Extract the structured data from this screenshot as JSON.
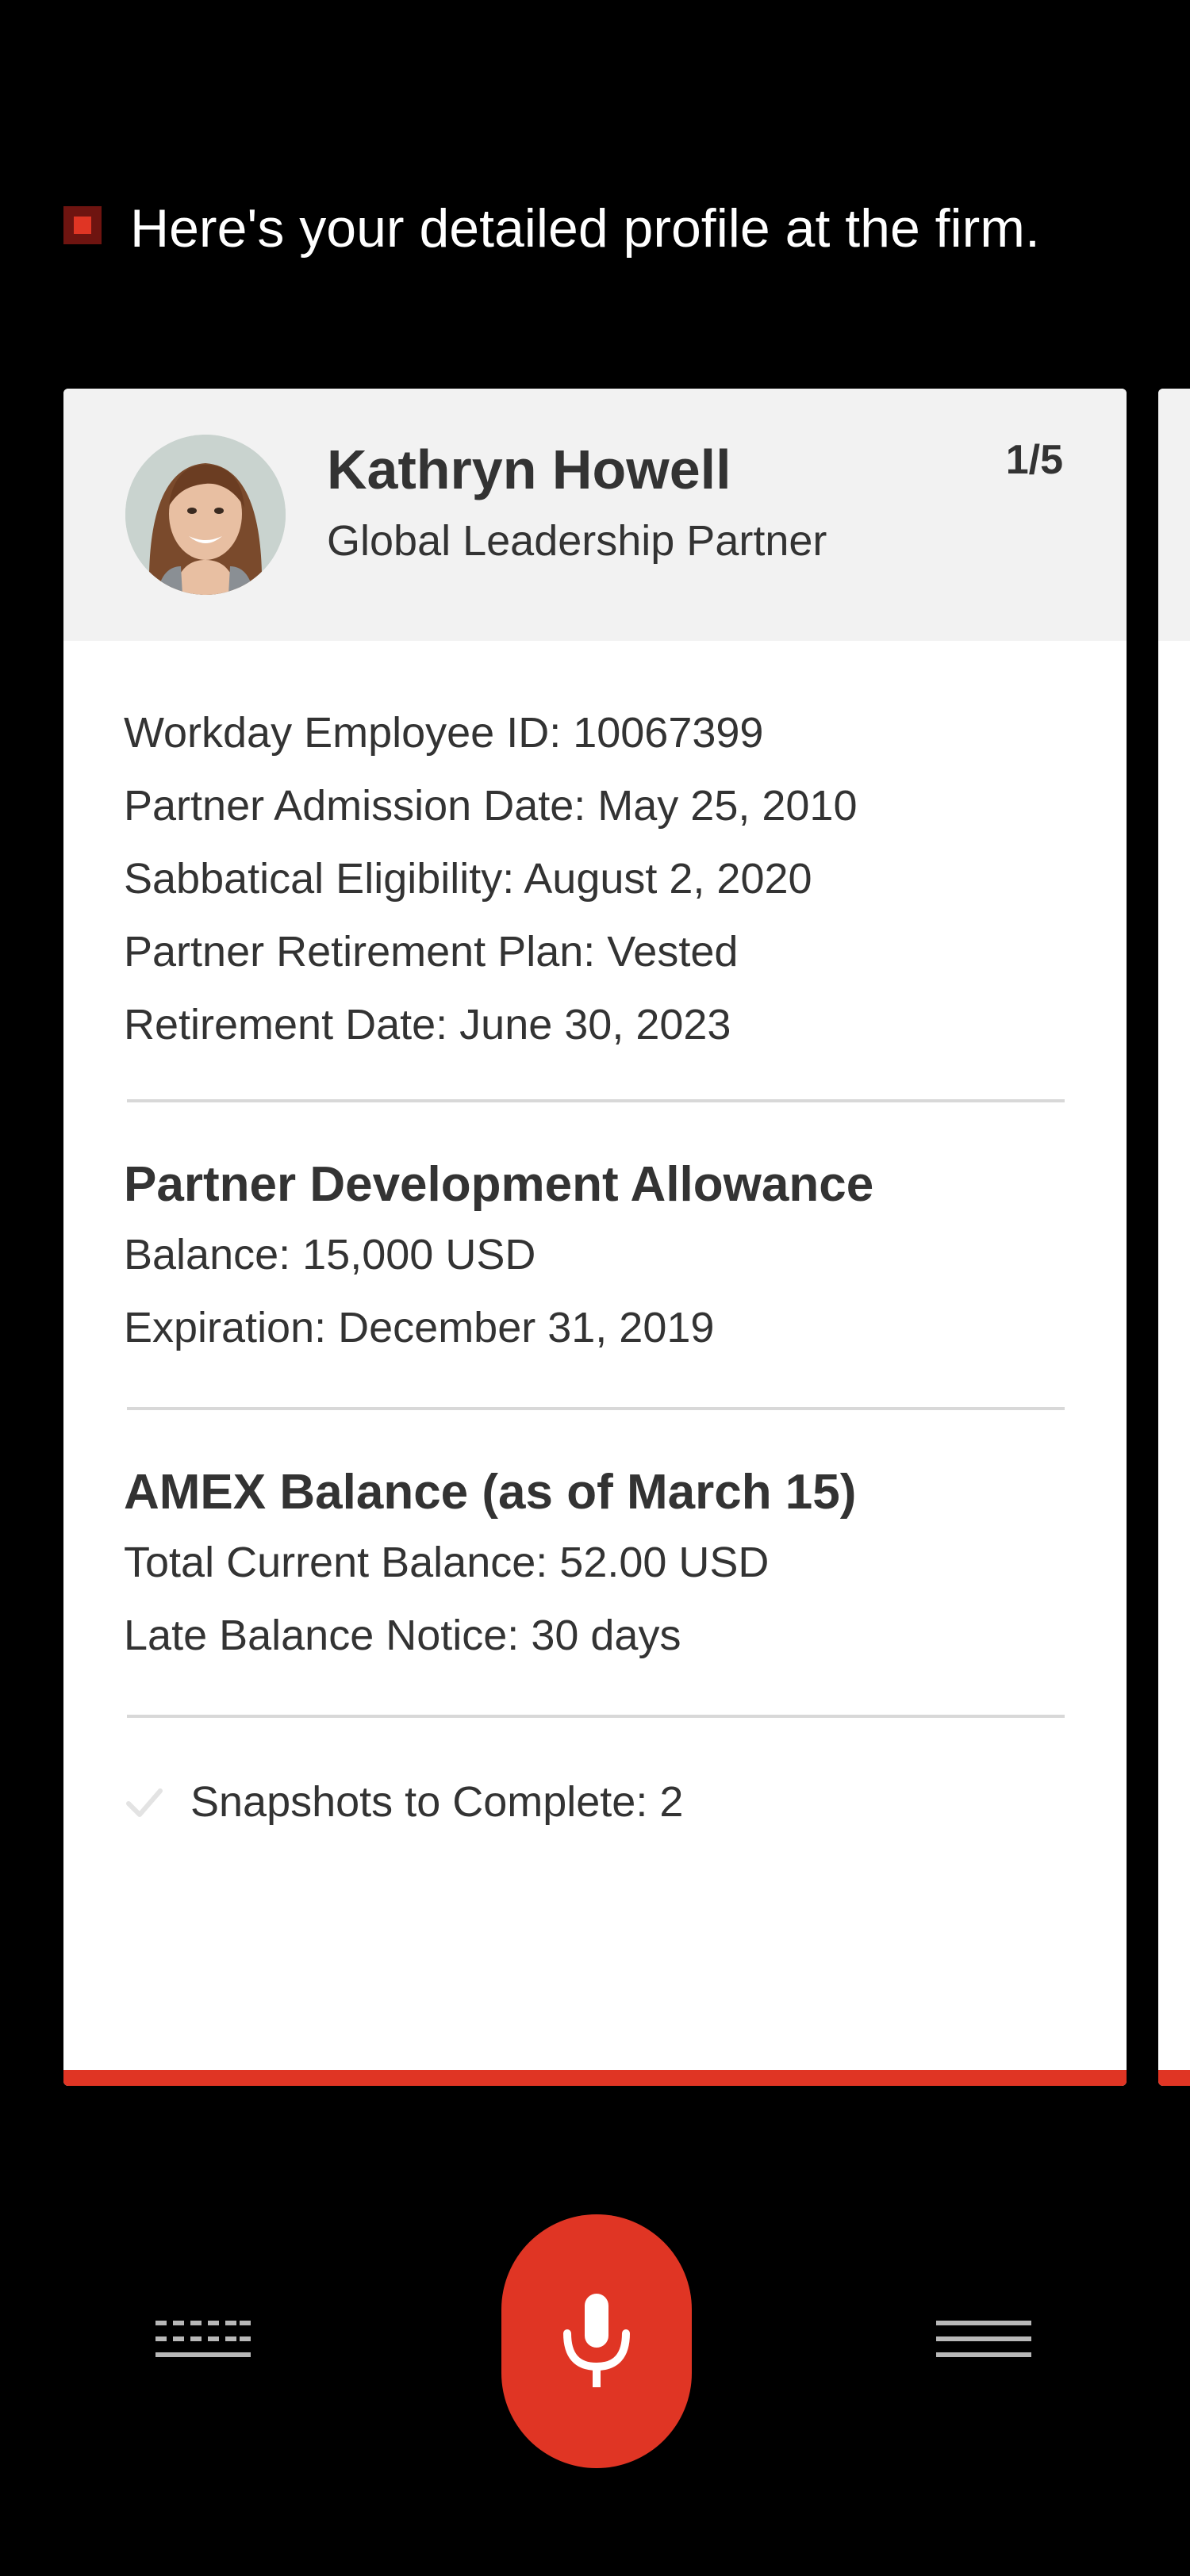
{
  "assistant": {
    "message": "Here's your detailed profile at the firm."
  },
  "profile_card": {
    "name": "Kathryn Howell",
    "role": "Global Leadership Partner",
    "pager": "1/5",
    "details": [
      "Workday Employee ID: 10067399",
      "Partner Admission Date: May 25, 2010",
      "Sabbatical Eligibility: August 2, 2020",
      "Partner Retirement Plan: Vested",
      "Retirement Date: June 30, 2023"
    ],
    "allowance": {
      "heading": "Partner Development Allowance",
      "lines": [
        "Balance: 15,000 USD",
        "Expiration: December 31, 2019"
      ]
    },
    "amex": {
      "heading": "AMEX Balance (as of March 15)",
      "lines": [
        "Total Current Balance: 52.00 USD",
        "Late Balance Notice: 30 days"
      ]
    },
    "snapshots": "Snapshots to Complete: 2"
  },
  "icons": {
    "keyboard": "keyboard-icon",
    "mic": "microphone-icon",
    "menu": "menu-icon",
    "check": "check-icon"
  },
  "colors": {
    "accent": "#e03524",
    "background": "#000000",
    "card": "#ffffff",
    "card_header": "#f2f2f2"
  }
}
